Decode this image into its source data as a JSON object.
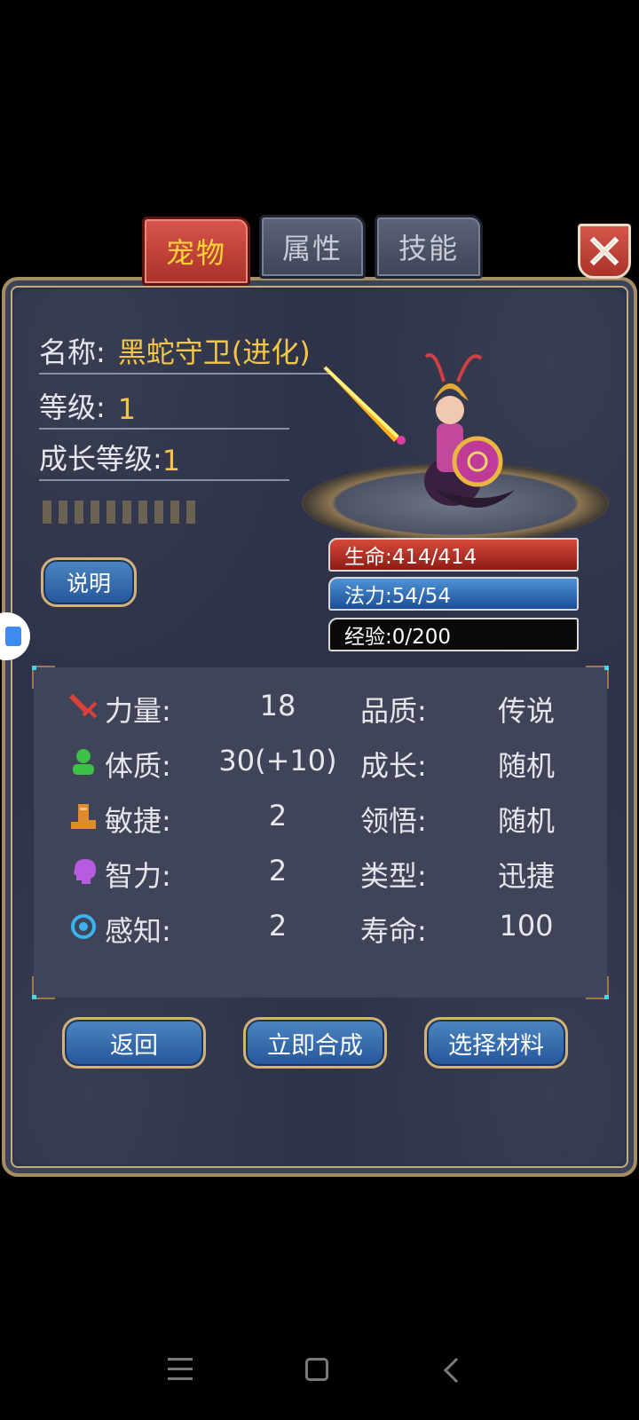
{
  "tabs": {
    "pet": "宠物",
    "attributes": "属性",
    "skills": "技能"
  },
  "pet": {
    "name_label": "名称:",
    "name": "黑蛇守卫(进化)",
    "level_label": "等级:",
    "level": "1",
    "growth_level_label": "成长等级:",
    "growth_level": "1",
    "growth_segments": 10
  },
  "buttons": {
    "description": "说明",
    "back": "返回",
    "merge_now": "立即合成",
    "select_material": "选择材料"
  },
  "bars": {
    "hp": "生命:414/414",
    "mp": "法力:54/54",
    "exp": "经验:0/200"
  },
  "stats": [
    {
      "icon": "sword-icon",
      "label": "力量:",
      "value": "18",
      "label2": "品质:",
      "value2": "传说"
    },
    {
      "icon": "person-icon",
      "label": "体质:",
      "value": "30(+10)",
      "label2": "成长:",
      "value2": "随机"
    },
    {
      "icon": "boot-icon",
      "label": "敏捷:",
      "value": "2",
      "label2": "领悟:",
      "value2": "随机"
    },
    {
      "icon": "head-icon",
      "label": "智力:",
      "value": "2",
      "label2": "类型:",
      "value2": "迅捷"
    },
    {
      "icon": "eye-ring-icon",
      "label": "感知:",
      "value": "2",
      "label2": "寿命:",
      "value2": "100"
    }
  ],
  "colors": {
    "panel": "#2e3349",
    "gold_text": "#f2c64a",
    "hp": "#c43a2e",
    "mp": "#2e6fb8"
  }
}
